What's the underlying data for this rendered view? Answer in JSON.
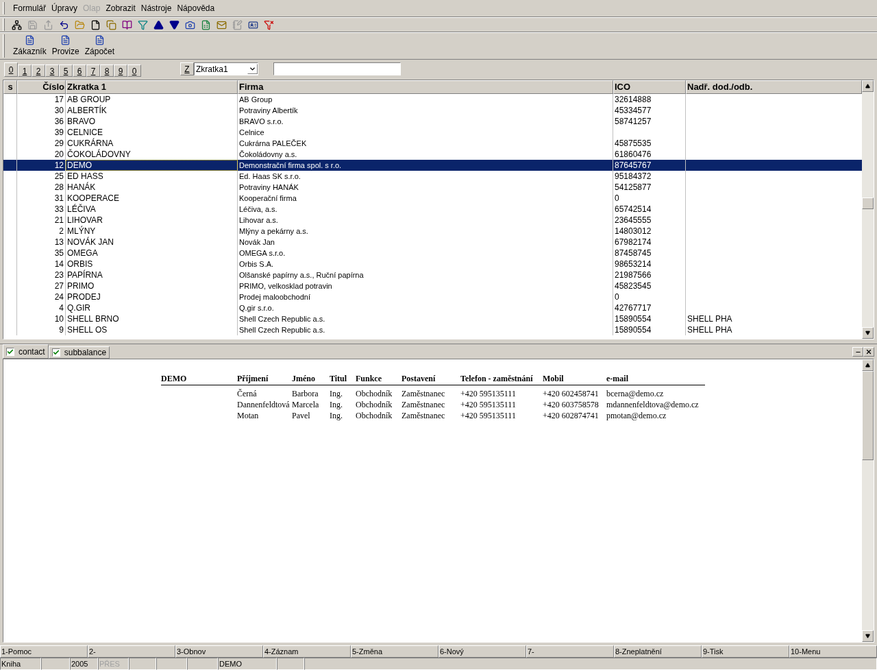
{
  "menu": [
    {
      "label": "Formulář",
      "disabled": false
    },
    {
      "label": "Úpravy",
      "disabled": false
    },
    {
      "label": "Olap",
      "disabled": true
    },
    {
      "label": "Zobrazit",
      "disabled": false
    },
    {
      "label": "Nástroje",
      "disabled": false
    },
    {
      "label": "Nápověda",
      "disabled": false
    }
  ],
  "toolbar": [
    {
      "kind": "tree",
      "disabled": false
    },
    {
      "kind": "save",
      "disabled": true
    },
    {
      "kind": "save-export",
      "disabled": true
    },
    {
      "kind": "undo",
      "disabled": false
    },
    {
      "kind": "open",
      "disabled": false
    },
    {
      "kind": "new",
      "disabled": false
    },
    {
      "kind": "copy",
      "disabled": false
    },
    {
      "kind": "book",
      "disabled": false
    },
    {
      "kind": "filter",
      "disabled": false
    },
    {
      "kind": "up",
      "disabled": false
    },
    {
      "kind": "down",
      "disabled": false
    },
    {
      "kind": "camera",
      "disabled": false
    },
    {
      "kind": "excel",
      "disabled": false
    },
    {
      "kind": "mail",
      "disabled": false
    },
    {
      "kind": "notes",
      "disabled": true
    },
    {
      "kind": "card",
      "disabled": false
    },
    {
      "kind": "filter-clear",
      "disabled": false
    }
  ],
  "forms": [
    "Zákazník",
    "Provize",
    "Zápočet"
  ],
  "letter_tabs": [
    {
      "label": "0",
      "selected": true
    },
    {
      "label": "1",
      "selected": false
    },
    {
      "label": "2",
      "selected": false
    },
    {
      "label": "3",
      "selected": false
    },
    {
      "label": "5",
      "selected": false
    },
    {
      "label": "6",
      "selected": false
    },
    {
      "label": "7",
      "selected": false
    },
    {
      "label": "8",
      "selected": false
    },
    {
      "label": "9",
      "selected": false
    },
    {
      "label": "0",
      "selected": false
    }
  ],
  "sort": {
    "button": "Z",
    "field": "Zkratka1"
  },
  "table": {
    "columns": [
      "s",
      "Číslo",
      "Zkratka 1",
      "Firma",
      "ICO",
      "Nadř. dod./odb."
    ],
    "rows": [
      {
        "cislo": "17",
        "zkratka": "AB GROUP",
        "firma": "AB Group",
        "ico": "32614888",
        "nadr": "",
        "selected": false
      },
      {
        "cislo": "30",
        "zkratka": "ALBERTÍK",
        "firma": "Potraviny Albertík",
        "ico": "45334577",
        "nadr": "",
        "selected": false
      },
      {
        "cislo": "36",
        "zkratka": "BRAVO",
        "firma": "BRAVO s.r.o.",
        "ico": "58741257",
        "nadr": "",
        "selected": false
      },
      {
        "cislo": "39",
        "zkratka": "CELNICE",
        "firma": "Celnice",
        "ico": "",
        "nadr": "",
        "selected": false
      },
      {
        "cislo": "29",
        "zkratka": "CUKRÁRNA",
        "firma": "Cukrárna PALEČEK",
        "ico": "45875535",
        "nadr": "",
        "selected": false
      },
      {
        "cislo": "20",
        "zkratka": "ČOKOLÁDOVNY",
        "firma": "Čokoládovny a.s.",
        "ico": "61860476",
        "nadr": "",
        "selected": false
      },
      {
        "cislo": "12",
        "zkratka": "DEMO",
        "firma": "Demonstrační firma spol. s r.o.",
        "ico": "87645767",
        "nadr": "",
        "selected": true
      },
      {
        "cislo": "25",
        "zkratka": "ED HASS",
        "firma": "Ed. Haas SK s.r.o.",
        "ico": "95184372",
        "nadr": "",
        "selected": false
      },
      {
        "cislo": "28",
        "zkratka": "HANÁK",
        "firma": "Potraviny HANÁK",
        "ico": "54125877",
        "nadr": "",
        "selected": false
      },
      {
        "cislo": "31",
        "zkratka": "KOOPERACE",
        "firma": "Kooperační firma",
        "ico": "0",
        "nadr": "",
        "selected": false
      },
      {
        "cislo": "33",
        "zkratka": "LÉČIVA",
        "firma": "Léčiva, a.s.",
        "ico": "65742514",
        "nadr": "",
        "selected": false
      },
      {
        "cislo": "21",
        "zkratka": "LIHOVAR",
        "firma": "Lihovar a.s.",
        "ico": "23645555",
        "nadr": "",
        "selected": false
      },
      {
        "cislo": "2",
        "zkratka": "MLÝNY",
        "firma": "Mlýny a pekárny a.s.",
        "ico": "14803012",
        "nadr": "",
        "selected": false
      },
      {
        "cislo": "13",
        "zkratka": "NOVÁK JAN",
        "firma": "Novák Jan",
        "ico": "67982174",
        "nadr": "",
        "selected": false
      },
      {
        "cislo": "35",
        "zkratka": "OMEGA",
        "firma": "OMEGA s.r.o.",
        "ico": "87458745",
        "nadr": "",
        "selected": false
      },
      {
        "cislo": "14",
        "zkratka": "ORBIS",
        "firma": "Orbis S.A.",
        "ico": "98653214",
        "nadr": "",
        "selected": false
      },
      {
        "cislo": "23",
        "zkratka": "PAPÍRNA",
        "firma": "Olšanské papírny a.s., Ruční papírna",
        "ico": "21987566",
        "nadr": "",
        "selected": false
      },
      {
        "cislo": "27",
        "zkratka": "PRIMO",
        "firma": "PRIMO, velkosklad potravin",
        "ico": "45823545",
        "nadr": "",
        "selected": false
      },
      {
        "cislo": "24",
        "zkratka": "PRODEJ",
        "firma": "Prodej maloobchodní",
        "ico": "0",
        "nadr": "",
        "selected": false
      },
      {
        "cislo": "4",
        "zkratka": "Q.GIR",
        "firma": "Q.gir s.r.o.",
        "ico": "42767717",
        "nadr": "",
        "selected": false
      },
      {
        "cislo": "10",
        "zkratka": "SHELL BRNO",
        "firma": "Shell Czech Republic a.s.",
        "ico": "15890554",
        "nadr": "SHELL PHA",
        "selected": false
      },
      {
        "cislo": "9",
        "zkratka": "SHELL OS",
        "firma": "Shell Czech Republic a.s.",
        "ico": "15890554",
        "nadr": "SHELL PHA",
        "selected": false
      }
    ]
  },
  "detail_tabs": [
    {
      "label": "contact",
      "checked": true,
      "selected": true
    },
    {
      "label": "subbalance",
      "checked": true,
      "selected": false
    }
  ],
  "report": {
    "company": "DEMO",
    "columns": [
      "Příjmení",
      "Jméno",
      "Titul",
      "Funkce",
      "Postavení",
      "Telefon - zaměstnání",
      "Mobil",
      "e-mail"
    ],
    "rows": [
      [
        "Černá",
        "Barbora",
        "Ing.",
        "Obchodník",
        "Zaměstnanec",
        "+420 595135111",
        "+420 602458741",
        "bcerna@demo.cz"
      ],
      [
        "Dannenfeldtová",
        "Marcela",
        "Ing.",
        "Obchodník",
        "Zaměstnanec",
        "+420 595135111",
        "+420 603758578",
        "mdannenfeldtova@demo.cz"
      ],
      [
        "Motan",
        "Pavel",
        "Ing.",
        "Obchodník",
        "Zaměstnanec",
        "+420 595135111",
        "+420 602874741",
        "pmotan@demo.cz"
      ]
    ]
  },
  "function_keys": [
    "1-Pomoc",
    "2-",
    "3-Obnov",
    "4-Záznam",
    "5-Změna",
    "6-Nový",
    "7-",
    "8-Zneplatnění",
    "9-Tisk",
    "10-Menu"
  ],
  "status_bar": [
    {
      "kind": "text",
      "text": "Kniha",
      "disabled": false
    },
    {
      "kind": "blank"
    },
    {
      "kind": "text",
      "text": "2005",
      "disabled": false
    },
    {
      "kind": "text",
      "text": "PŘES",
      "disabled": true
    },
    {
      "kind": "blank"
    },
    {
      "kind": "blank"
    },
    {
      "kind": "blank"
    },
    {
      "kind": "text",
      "text": "DEMO",
      "disabled": false
    },
    {
      "kind": "blank"
    }
  ]
}
